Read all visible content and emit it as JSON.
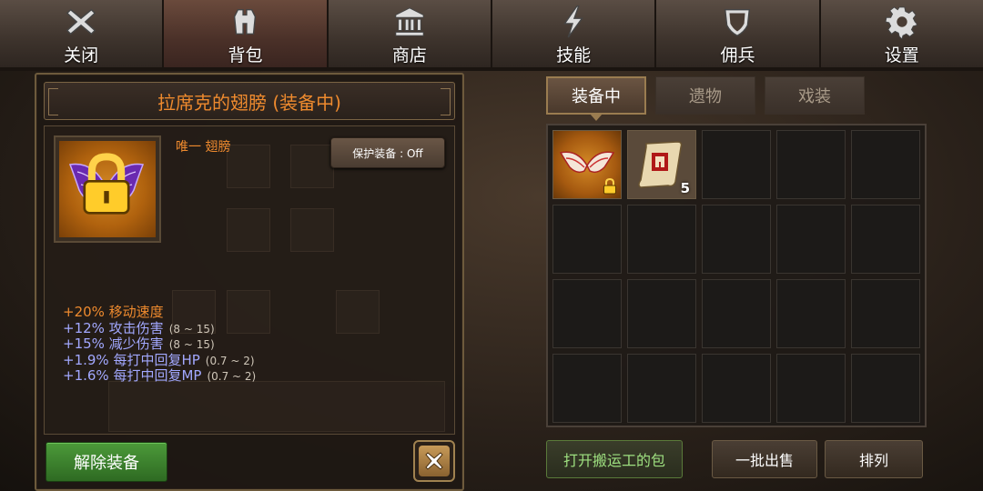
{
  "nav": [
    {
      "label": "关闭",
      "icon": "close-icon"
    },
    {
      "label": "背包",
      "icon": "backpack-icon"
    },
    {
      "label": "商店",
      "icon": "shop-icon"
    },
    {
      "label": "技能",
      "icon": "skill-icon"
    },
    {
      "label": "佣兵",
      "icon": "mercenary-shield-icon"
    },
    {
      "label": "设置",
      "icon": "gear-icon"
    }
  ],
  "active_nav": "背包",
  "item": {
    "title": "拉席克的翅膀 (装备中)",
    "type": "唯一  翅膀",
    "protect_label": "保护装备 : Off",
    "locked": true,
    "stats": [
      {
        "text": "+20% 移动速度",
        "range": "",
        "color": "orange"
      },
      {
        "text": "+12% 攻击伤害",
        "range": "(8 ~ 15)",
        "color": "blue"
      },
      {
        "text": "+15% 减少伤害",
        "range": "(8 ~ 15)",
        "color": "blue"
      },
      {
        "text": "+1.9% 每打中回复HP",
        "range": "(0.7 ~ 2)",
        "color": "blue"
      },
      {
        "text": "+1.6% 每打中回复MP",
        "range": "(0.7 ~ 2)",
        "color": "blue"
      }
    ],
    "unequip_label": "解除装备"
  },
  "inventory": {
    "tabs": [
      "装备中",
      "遗物",
      "戏装"
    ],
    "active_tab": "装备中",
    "slots": [
      {
        "icon": "wings-icon",
        "locked": true,
        "count": ""
      },
      {
        "icon": "scroll-icon",
        "locked": false,
        "count": "5"
      }
    ],
    "total_slots": 20
  },
  "buttons": {
    "porter": "打开搬运工的包",
    "sell": "一批出售",
    "sort": "排列"
  },
  "colors": {
    "accent_orange": "#ee8a2e",
    "stat_blue": "#a2a8ff",
    "unequip_green": "#3e8a2e"
  }
}
